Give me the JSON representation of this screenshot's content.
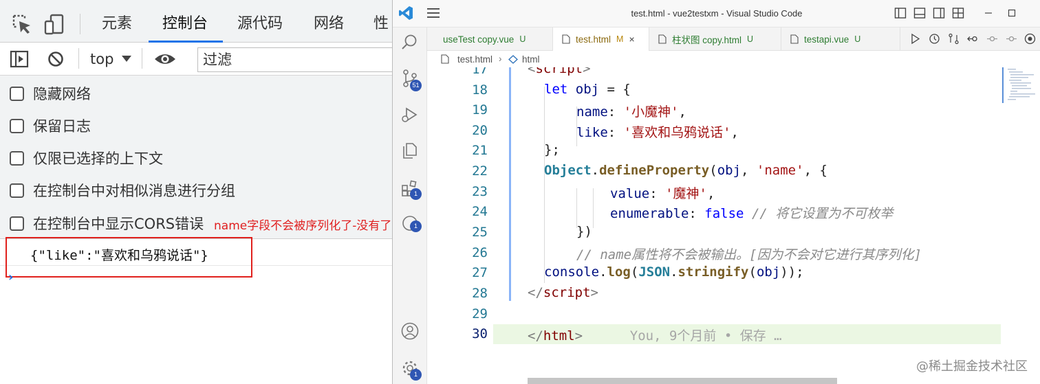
{
  "devtools": {
    "tabs": [
      "元素",
      "控制台",
      "源代码",
      "网络",
      "性能"
    ],
    "toolbar": {
      "context": "top",
      "filter_placeholder": "过滤"
    },
    "options": [
      "隐藏网络",
      "保留日志",
      "仅限已选择的上下文",
      "在控制台中对相似消息进行分组",
      "在控制台中显示CORS错误"
    ],
    "annotation": "name字段不会被序列化了-没有了",
    "console_output": "{\"like\":\"喜欢和乌鸦说话\"}",
    "prompt": "›"
  },
  "vscode": {
    "title": "test.html - vue2testxm - Visual Studio Code",
    "activity_badges": {
      "source_control": "51",
      "extensions": "1",
      "remote": "1",
      "settings": "1"
    },
    "tabs": [
      {
        "label": "useTest copy.vue",
        "status": "U",
        "status_color": "#2e7d32",
        "label_color": "#2e7d32"
      },
      {
        "label": "test.html",
        "status": "M",
        "status_color": "#b8860b",
        "label_color": "#8b6a10",
        "close": "×"
      },
      {
        "label": "柱状图 copy.html",
        "status": "U",
        "status_color": "#2e7d32",
        "label_color": "#2e7d32"
      },
      {
        "label": "testapi.vue",
        "status": "U",
        "status_color": "#2e7d32",
        "label_color": "#2e7d32"
      }
    ],
    "breadcrumb": [
      "test.html",
      "html"
    ],
    "line_numbers": [
      "17",
      "18",
      "19",
      "20",
      "21",
      "22",
      "23",
      "24",
      "25",
      "26",
      "27",
      "28",
      "29",
      "30"
    ],
    "code": {
      "l17": "script",
      "l18_kw": "let",
      "l18_var": "obj",
      "l18_rest": " = {",
      "l19_key": "name",
      "l19_str": "'小魔神'",
      "l20_key": "like",
      "l20_str": "'喜欢和乌鸦说话'",
      "l21": "};",
      "l22_obj": "Object",
      "l22_fn": "defineProperty",
      "l22_var": "obj",
      "l22_str": "'name'",
      "l23_key": "value",
      "l23_str": "'魔神'",
      "l24_key": "enumerable",
      "l24_bool": "false",
      "l24_comment": "// 将它设置为不可枚举",
      "l25": "})",
      "l26_comment": "// name属性将不会被输出。[因为不会对它进行其序列化]",
      "l27_var": "console",
      "l27_fn": "log",
      "l27_obj": "JSON",
      "l27_fn2": "stringify",
      "l27_arg": "obj",
      "l28": "script",
      "l30": "html",
      "l30_blame": "You, 9个月前 • 保存 …"
    }
  },
  "watermark": "@稀土掘金技术社区",
  "colors": {
    "accent_blue": "#1a73e8",
    "annotation_red": "#e02020",
    "vscode_badge": "#2f56b3"
  }
}
